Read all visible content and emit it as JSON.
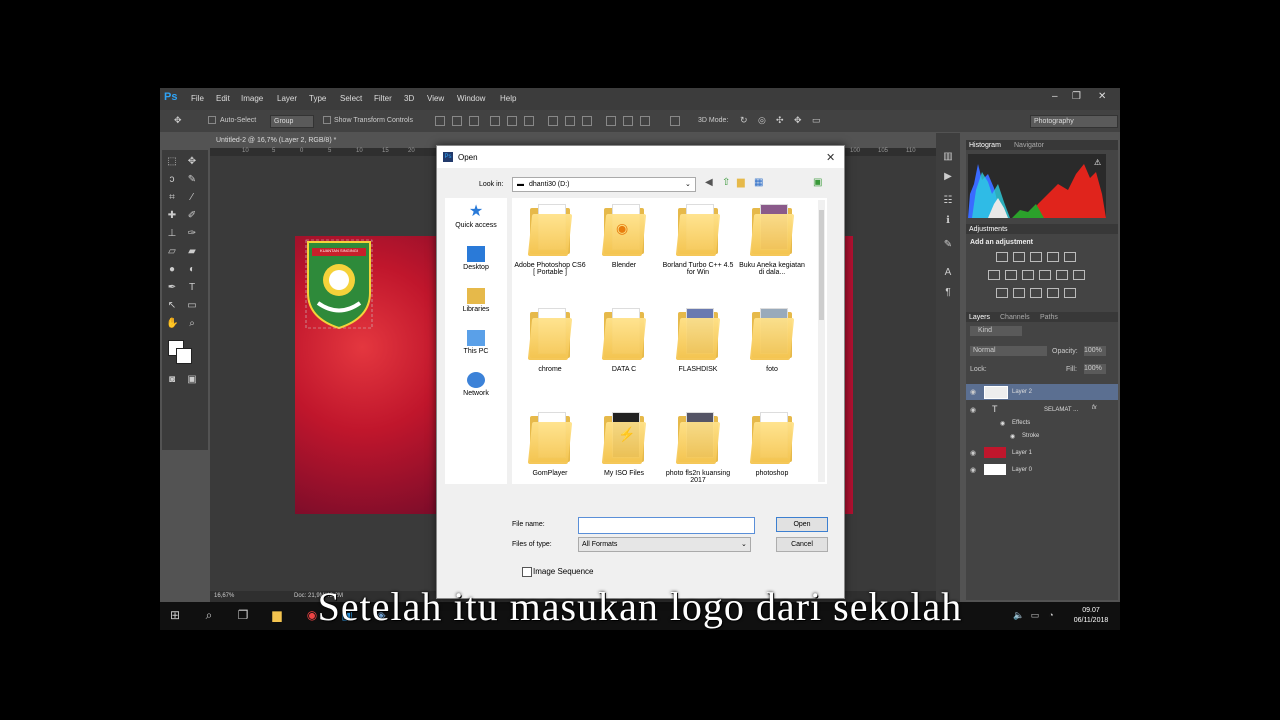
{
  "menubar": {
    "app_logo": "Ps",
    "items": [
      "File",
      "Edit",
      "Image",
      "Layer",
      "Type",
      "Select",
      "Filter",
      "3D",
      "View",
      "Window",
      "Help"
    ],
    "controls": [
      "–",
      "❐",
      "✕"
    ]
  },
  "options_bar": {
    "auto_select_label": "Auto-Select",
    "auto_select_value": "Group",
    "transform_label": "Show Transform Controls",
    "mode_3d_label": "3D Mode:",
    "workspace": "Photography"
  },
  "document": {
    "tab_label": "Untitled-2 @ 16,7% (Layer 2, RGB/8) *",
    "ruler_marks": [
      "10",
      "5",
      "0",
      "5",
      "10",
      "15",
      "20",
      "100",
      "105",
      "110"
    ],
    "zoom": "16,67%",
    "doc_info": "Doc: 21,9M/43,2M",
    "logo_banner_text": "KUANTAN SINGINGI"
  },
  "panels": {
    "top_tabs": [
      "Histogram",
      "Navigator"
    ],
    "adjustments_tab": "Adjustments",
    "add_adjustment": "Add an adjustment",
    "layers_tabs": [
      "Layers",
      "Channels",
      "Paths"
    ],
    "kind_label": "Kind",
    "blend_mode": "Normal",
    "opacity_label": "Opacity:",
    "opacity_value": "100%",
    "lock_label": "Lock:",
    "fill_label": "Fill:",
    "fill_value": "100%",
    "layers": [
      {
        "name": "Layer 2"
      },
      {
        "name": "SELAMAT ..."
      },
      {
        "name": "Effects"
      },
      {
        "name": "Stroke"
      },
      {
        "name": "Layer 1"
      },
      {
        "name": "Layer 0"
      }
    ]
  },
  "dialog": {
    "title": "Open",
    "look_in_label": "Look in:",
    "look_in_value": "dhanti30 (D:)",
    "sidebar": [
      "Quick access",
      "Desktop",
      "Libraries",
      "This PC",
      "Network"
    ],
    "files": [
      {
        "name": "Adobe Photoshop CS6 [ Portable ]"
      },
      {
        "name": "Blender"
      },
      {
        "name": "Borland Turbo C++ 4.5 for Win"
      },
      {
        "name": "Buku Aneka kegiatan di dala..."
      },
      {
        "name": "chrome"
      },
      {
        "name": "DATA C"
      },
      {
        "name": "FLASHDISK"
      },
      {
        "name": "foto"
      },
      {
        "name": "GomPlayer"
      },
      {
        "name": "My ISO Files"
      },
      {
        "name": "photo fls2n kuansing 2017"
      },
      {
        "name": "photoshop"
      }
    ],
    "file_name_label": "File name:",
    "file_name_value": "",
    "file_type_label": "Files of type:",
    "file_type_value": "All Formats",
    "open_button": "Open",
    "cancel_button": "Cancel",
    "image_sequence_label": "Image Sequence"
  },
  "taskbar": {
    "time": "09.07",
    "date": "06/11/2018"
  },
  "caption": "Setelah itu masukan logo dari sekolah"
}
